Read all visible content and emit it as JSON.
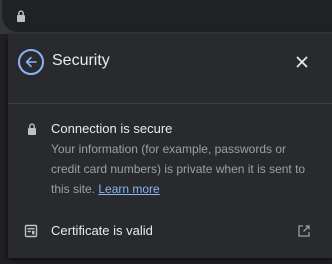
{
  "header": {
    "title": "Security",
    "back_icon": "arrow-back-icon",
    "close_icon": "close-icon"
  },
  "connection": {
    "title": "Connection is secure",
    "description": "Your information (for example, passwords or credit card numbers) is private when it is sent to this site.",
    "learn_more": "Learn more"
  },
  "certificate": {
    "label": "Certificate is valid",
    "icon": "certificate-icon",
    "external_icon": "open-in-new-icon"
  },
  "colors": {
    "panel_bg": "#292a2d",
    "accent": "#8ab4f8",
    "text_primary": "#e8eaed",
    "text_secondary": "#9aa0a6"
  }
}
